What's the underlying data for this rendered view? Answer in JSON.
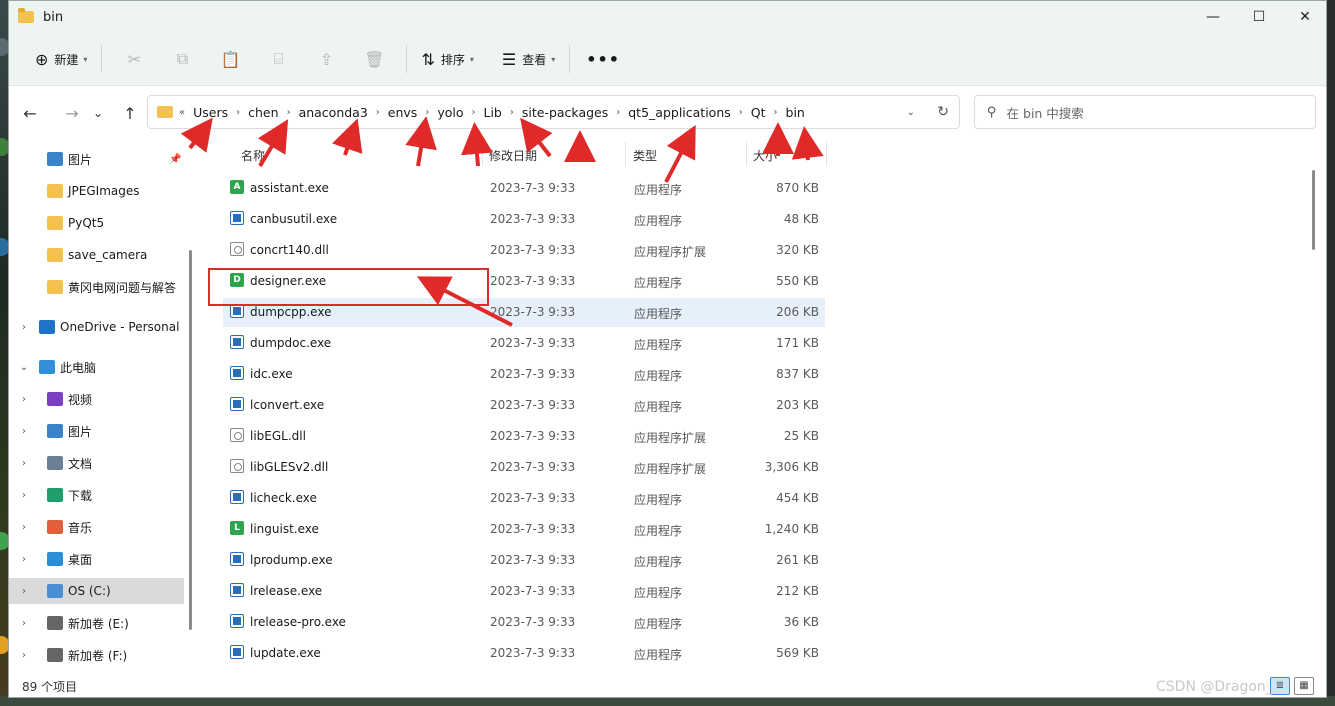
{
  "window": {
    "title": "bin",
    "minimize_glyph": "—",
    "maximize_glyph": "☐",
    "close_glyph": "✕"
  },
  "toolbar": {
    "new_label": "新建",
    "sort_label": "排序",
    "view_label": "查看",
    "more_glyph": "•••",
    "icons": [
      "cut-icon",
      "copy-icon",
      "paste-icon",
      "rename-icon",
      "share-icon",
      "delete-icon"
    ]
  },
  "nav": {
    "back_glyph": "←",
    "forward_glyph": "→",
    "recent_glyph": "⌄",
    "up_glyph": "↑"
  },
  "address": {
    "overflow": "«",
    "crumbs": [
      "Users",
      "chen",
      "anaconda3",
      "envs",
      "yolo",
      "Lib",
      "site-packages",
      "qt5_applications",
      "Qt",
      "bin"
    ],
    "separator": "›",
    "dropdown_glyph": "⌄",
    "refresh_glyph": "↻"
  },
  "search": {
    "placeholder": "在 bin 中搜索"
  },
  "sidebar": {
    "items": [
      {
        "label": "图片",
        "icon": "pictures-icon",
        "color": "#3b83c8",
        "pinned": true
      },
      {
        "label": "JPEGImages",
        "icon": "folder-icon",
        "color": "#f2c14e"
      },
      {
        "label": "PyQt5",
        "icon": "folder-icon",
        "color": "#f2c14e"
      },
      {
        "label": "save_camera",
        "icon": "folder-icon",
        "color": "#f2c14e"
      },
      {
        "label": "黄冈电网问题与解答",
        "icon": "folder-icon",
        "color": "#f2c14e"
      },
      {
        "label": "OneDrive - Personal",
        "icon": "cloud-icon",
        "color": "#1e73c8",
        "expand": "›"
      },
      {
        "label": "此电脑",
        "icon": "pc-icon",
        "color": "#2f8fd8",
        "expand": "⌄"
      },
      {
        "label": "视频",
        "icon": "video-icon",
        "color": "#7b3fc4",
        "expand": "›"
      },
      {
        "label": "图片",
        "icon": "pictures-icon",
        "color": "#3b83c8",
        "expand": "›"
      },
      {
        "label": "文档",
        "icon": "documents-icon",
        "color": "#6b7f95",
        "expand": "›"
      },
      {
        "label": "下载",
        "icon": "download-icon",
        "color": "#1e9e6a",
        "expand": "›"
      },
      {
        "label": "音乐",
        "icon": "music-icon",
        "color": "#e0603c",
        "expand": "›"
      },
      {
        "label": "桌面",
        "icon": "desktop-icon",
        "color": "#2a8fd8",
        "expand": "›"
      },
      {
        "label": "OS (C:)",
        "icon": "drive-c-icon",
        "color": "#4a8fd0",
        "expand": "›",
        "selected": true
      },
      {
        "label": "新加卷 (E:)",
        "icon": "drive-icon",
        "color": "#666666",
        "expand": "›"
      },
      {
        "label": "新加卷 (F:)",
        "icon": "drive-icon",
        "color": "#666666",
        "expand": "›"
      }
    ]
  },
  "columns": {
    "name": "名称",
    "date": "修改日期",
    "type": "类型",
    "size": "大小"
  },
  "files": [
    {
      "name": "assistant.exe",
      "date": "2023-7-3 9:33",
      "type": "应用程序",
      "size": "870 KB",
      "icon": "qt-assistant-icon",
      "badge": "A",
      "badge_color": "#2ea44f"
    },
    {
      "name": "canbusutil.exe",
      "date": "2023-7-3 9:33",
      "type": "应用程序",
      "size": "48 KB",
      "icon": "exe-icon"
    },
    {
      "name": "concrt140.dll",
      "date": "2023-7-3 9:33",
      "type": "应用程序扩展",
      "size": "320 KB",
      "icon": "dll-icon"
    },
    {
      "name": "designer.exe",
      "date": "2023-7-3 9:33",
      "type": "应用程序",
      "size": "550 KB",
      "icon": "qt-designer-icon",
      "badge": "D",
      "badge_color": "#2ea44f"
    },
    {
      "name": "dumpcpp.exe",
      "date": "2023-7-3 9:33",
      "type": "应用程序",
      "size": "206 KB",
      "icon": "exe-icon",
      "highlighted": true
    },
    {
      "name": "dumpdoc.exe",
      "date": "2023-7-3 9:33",
      "type": "应用程序",
      "size": "171 KB",
      "icon": "exe-icon"
    },
    {
      "name": "idc.exe",
      "date": "2023-7-3 9:33",
      "type": "应用程序",
      "size": "837 KB",
      "icon": "exe-icon"
    },
    {
      "name": "lconvert.exe",
      "date": "2023-7-3 9:33",
      "type": "应用程序",
      "size": "203 KB",
      "icon": "exe-icon"
    },
    {
      "name": "libEGL.dll",
      "date": "2023-7-3 9:33",
      "type": "应用程序扩展",
      "size": "25 KB",
      "icon": "dll-icon"
    },
    {
      "name": "libGLESv2.dll",
      "date": "2023-7-3 9:33",
      "type": "应用程序扩展",
      "size": "3,306 KB",
      "icon": "dll-icon"
    },
    {
      "name": "licheck.exe",
      "date": "2023-7-3 9:33",
      "type": "应用程序",
      "size": "454 KB",
      "icon": "exe-icon"
    },
    {
      "name": "linguist.exe",
      "date": "2023-7-3 9:33",
      "type": "应用程序",
      "size": "1,240 KB",
      "icon": "qt-linguist-icon",
      "badge": "L",
      "badge_color": "#2ea44f"
    },
    {
      "name": "lprodump.exe",
      "date": "2023-7-3 9:33",
      "type": "应用程序",
      "size": "261 KB",
      "icon": "exe-icon"
    },
    {
      "name": "lrelease.exe",
      "date": "2023-7-3 9:33",
      "type": "应用程序",
      "size": "212 KB",
      "icon": "exe-icon"
    },
    {
      "name": "lrelease-pro.exe",
      "date": "2023-7-3 9:33",
      "type": "应用程序",
      "size": "36 KB",
      "icon": "exe-icon"
    },
    {
      "name": "lupdate.exe",
      "date": "2023-7-3 9:33",
      "type": "应用程序",
      "size": "569 KB",
      "icon": "exe-icon"
    }
  ],
  "status": {
    "count": "89 个项目"
  },
  "watermark": "CSDN @Dragon_",
  "colors": {
    "annotation": "#e02a2a",
    "selection": "#e5f0fb",
    "sidebar_selected": "#dadada"
  }
}
